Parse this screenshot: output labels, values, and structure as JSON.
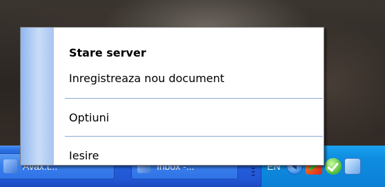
{
  "context_menu": {
    "items": [
      {
        "label": "Stare server",
        "bold": true
      },
      {
        "label": "Inregistreaza nou document"
      },
      {
        "label": "Optiuni"
      },
      {
        "label": "Iesire"
      }
    ]
  },
  "taskbar": {
    "buttons": [
      {
        "label": "Avax.t...",
        "icon": "app-icon"
      },
      {
        "label": "Inbox -...",
        "icon": "mail-icon"
      }
    ],
    "tray": {
      "language": "EN",
      "icons": [
        "back-arrow-icon",
        "tools-icon",
        "security-check-icon",
        "network-icon"
      ]
    }
  },
  "colors": {
    "taskbar_blue": "#245edb",
    "tray_blue": "#0f8de0",
    "menu_sidebar": "#b5cff4",
    "menu_separator": "#8aa6d9"
  }
}
